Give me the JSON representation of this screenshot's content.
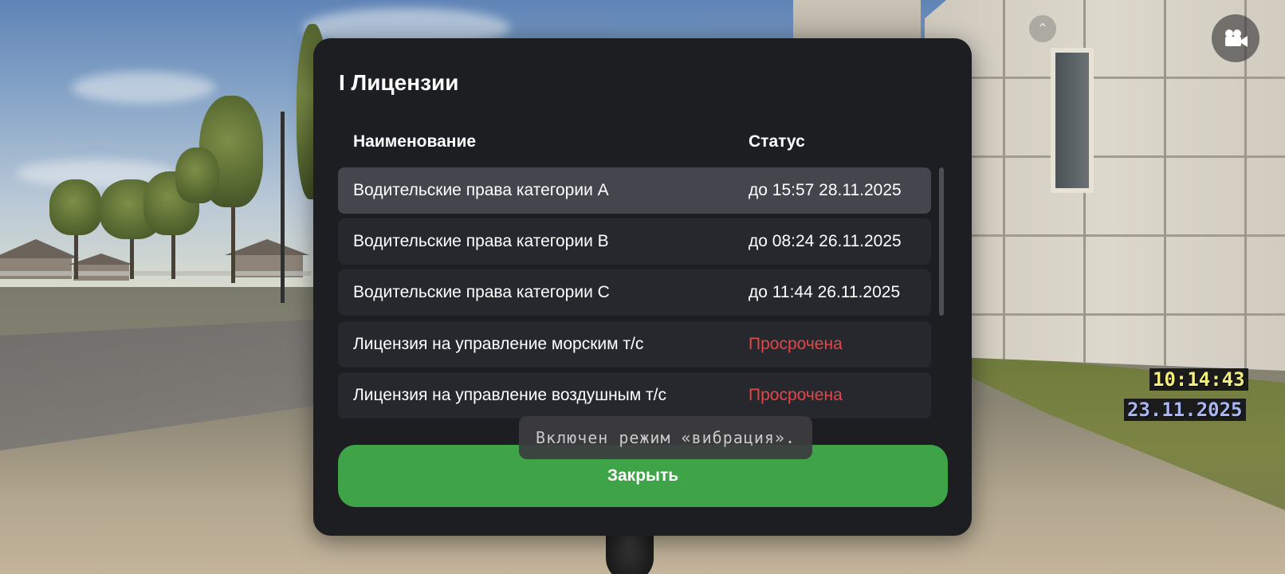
{
  "modal": {
    "title": "I Лицензии",
    "columns": {
      "name": "Наименование",
      "status": "Статус"
    },
    "rows": [
      {
        "name": "Водительские права категории A",
        "status": "до 15:57 28.11.2025",
        "expired": false,
        "selected": true
      },
      {
        "name": "Водительские права категории B",
        "status": "до 08:24 26.11.2025",
        "expired": false,
        "selected": false
      },
      {
        "name": "Водительские права категории C",
        "status": "до 11:44 26.11.2025",
        "expired": false,
        "selected": false
      },
      {
        "name": "Лицензия на управление морским т/с",
        "status": "Просрочена",
        "expired": true,
        "selected": false
      },
      {
        "name": "Лицензия на управление воздушным т/с",
        "status": "Просрочена",
        "expired": true,
        "selected": false
      }
    ],
    "close_label": "Закрыть"
  },
  "toast": {
    "text": "Включен режим «вибрация»."
  },
  "hud": {
    "time": "10:14:43",
    "date": "23.11.2025",
    "camera_icon": "video-camera-icon",
    "collapse_icon": "chevron-up-icon"
  },
  "colors": {
    "modal_bg": "#1d1e22",
    "row_bg": "#27282d",
    "row_selected_bg": "#45464d",
    "expired": "#e34747",
    "close_button": "#3ea447",
    "hud_time": "#f3f07a",
    "hud_date": "#a7b6f3"
  }
}
